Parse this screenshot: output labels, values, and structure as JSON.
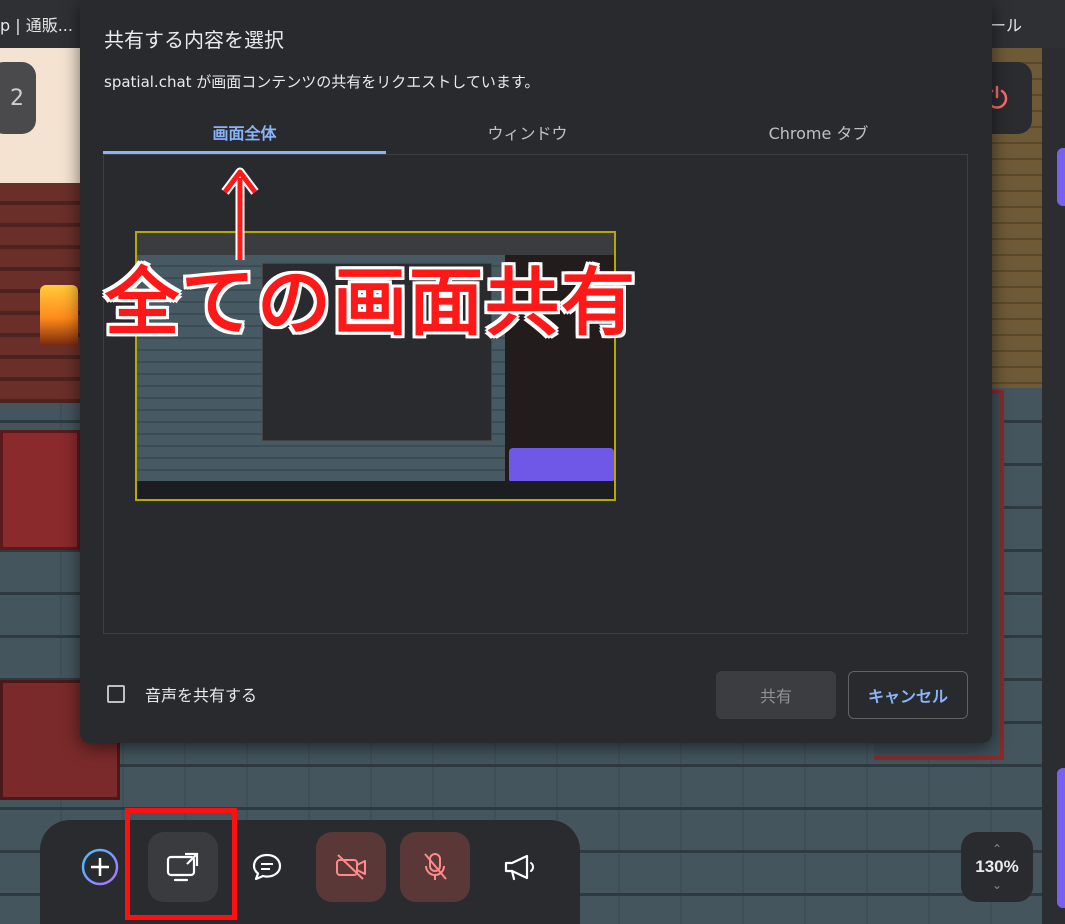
{
  "background": {
    "tab_text_left": "p | 通販...",
    "tab_text_right": "ール",
    "left_chip_text": "2"
  },
  "dialog": {
    "title": "共有する内容を選択",
    "subtitle": "spatial.chat が画面コンテンツの共有をリクエストしています。",
    "tabs": [
      {
        "label": "画面全体",
        "selected": true
      },
      {
        "label": "ウィンドウ",
        "selected": false
      },
      {
        "label": "Chrome タブ",
        "selected": false
      }
    ],
    "audio_checkbox": {
      "label": "音声を共有する",
      "checked": false
    },
    "share_button": "共有",
    "cancel_button": "キャンセル"
  },
  "annotation": {
    "text": "全ての画面共有",
    "color": "#ff1818"
  },
  "toolbar": {
    "buttons": [
      {
        "name": "add",
        "icon": "plus-circle-icon"
      },
      {
        "name": "screen-share",
        "icon": "screen-share-icon",
        "highlighted": true
      },
      {
        "name": "chat",
        "icon": "chat-bubble-icon"
      },
      {
        "name": "camera",
        "icon": "camera-off-icon",
        "state": "off"
      },
      {
        "name": "microphone",
        "icon": "mic-off-icon",
        "state": "off"
      },
      {
        "name": "broadcast",
        "icon": "megaphone-icon"
      }
    ],
    "zoom": "130%"
  },
  "colors": {
    "accent": "#8ab4f8",
    "dialog_bg": "#292a2d",
    "highlight": "#ff1010",
    "muted_button_bg": "#5a3838",
    "muted_icon": "#ff8a8a"
  }
}
